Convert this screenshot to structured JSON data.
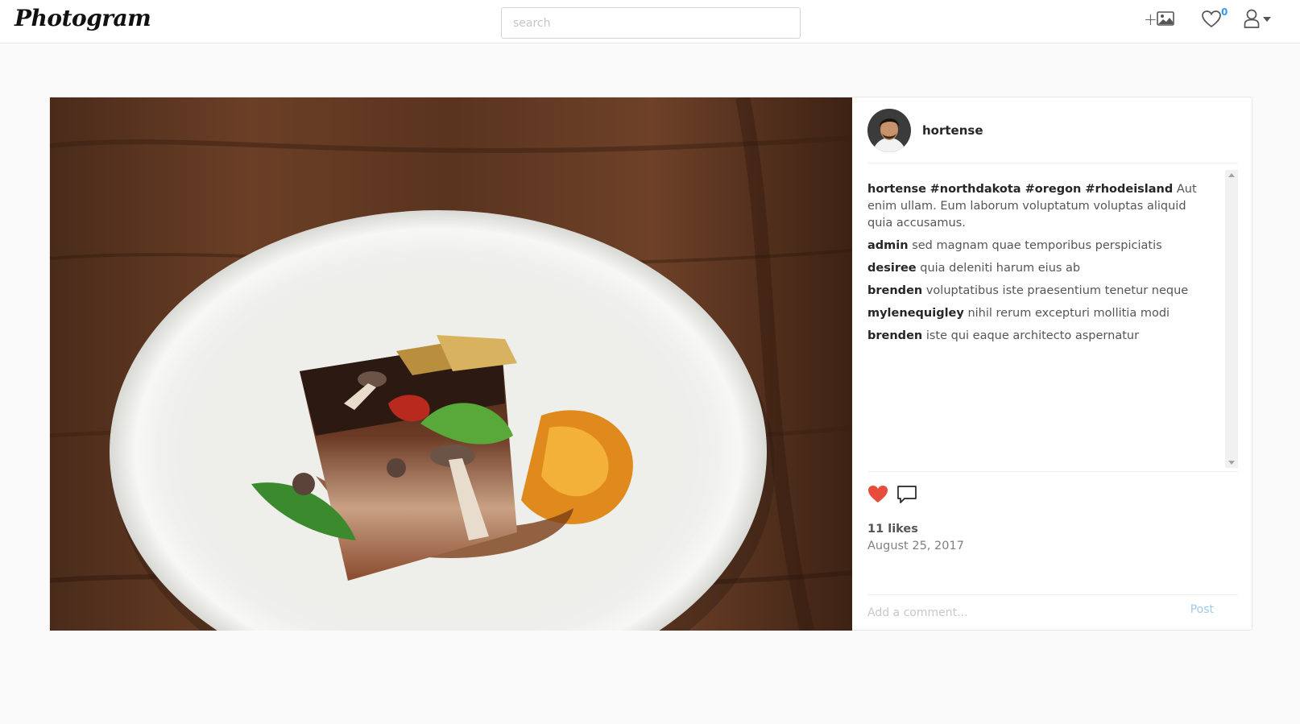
{
  "navbar": {
    "brand": "Photogram",
    "search_placeholder": "search",
    "upload_plus": "+",
    "likes_count": "0"
  },
  "post": {
    "author": "hortense",
    "caption": {
      "user": "hortense",
      "tags": "#northdakota #oregon #rhodeisland",
      "text": "Aut enim ullam. Eum laborum voluptatum voluptas aliquid quia accusamus."
    },
    "comments": [
      {
        "user": "admin",
        "text": "sed magnam quae temporibus perspiciatis"
      },
      {
        "user": "desiree",
        "text": "quia deleniti harum eius ab"
      },
      {
        "user": "brenden",
        "text": "voluptatibus iste praesentium tenetur neque"
      },
      {
        "user": "mylenequigley",
        "text": "nihil rerum excepturi mollitia modi"
      },
      {
        "user": "brenden",
        "text": "iste qui eaque architecto aspernatur"
      }
    ],
    "likes": "11 likes",
    "date": "August 25, 2017",
    "comment_placeholder": "Add a comment...",
    "post_label": "Post"
  },
  "icons": {
    "upload": "image-icon",
    "likes": "heart-outline-icon",
    "user": "user-icon",
    "like": "heart-filled-icon",
    "comment": "speech-bubble-icon"
  },
  "colors": {
    "like": "#e74c3c",
    "link": "#3897f0",
    "post_button": "#9fcaf2"
  }
}
